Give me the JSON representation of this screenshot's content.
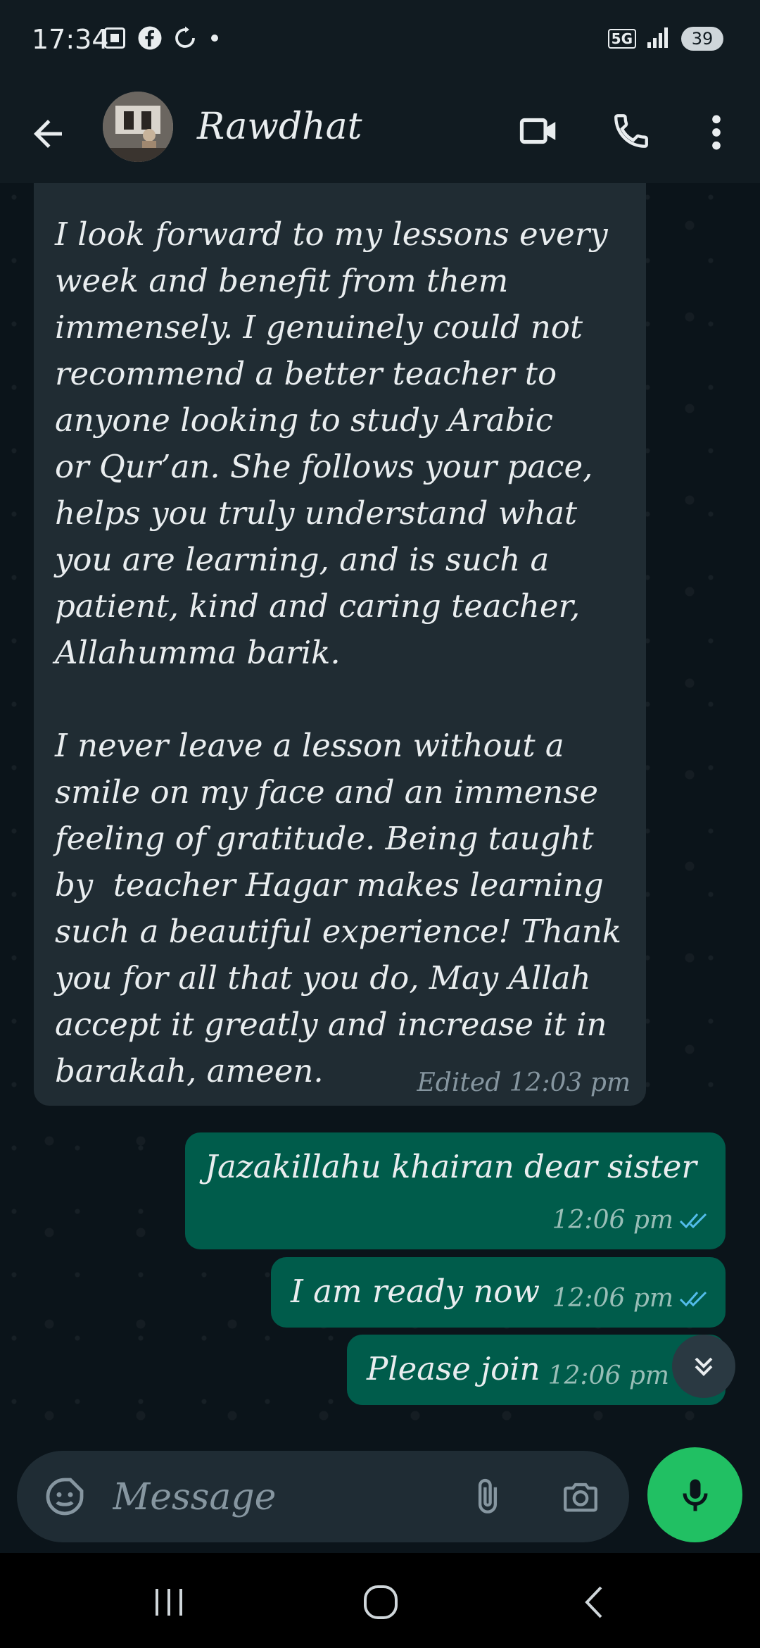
{
  "status_bar": {
    "time": "17:34",
    "network": "5G",
    "battery": "39"
  },
  "header": {
    "contact_name": "Rawdhat"
  },
  "messages": {
    "incoming": {
      "text": "I look forward to my lessons every\nweek and benefit from them\nimmensely. I genuinely could not\nrecommend a better teacher to\nanyone looking to study Arabic\nor Qur’an. She follows your pace,\nhelps you truly understand what\nyou are learning, and is such a\npatient, kind and caring teacher,\nAllahumma barik.\n\nI never leave a lesson without a\nsmile on my face and an immense\nfeeling of gratitude. Being taught\nby  teacher Hagar makes learning\nsuch a beautiful experience! Thank\nyou for all that you do, May Allah\naccept it greatly and increase it in\nbarakah, ameen.",
      "meta": "Edited 12:03 pm"
    },
    "outgoing": [
      {
        "text": "Jazakillahu khairan dear sister",
        "time": "12:06 pm"
      },
      {
        "text": "I am ready now",
        "time": "12:06 pm"
      },
      {
        "text": "Please join",
        "time": "12:06 pm"
      }
    ]
  },
  "composer": {
    "placeholder": "Message"
  },
  "colors": {
    "accent": "#21c063",
    "outgoing_bubble": "#005c4b",
    "incoming_bubble": "#202c33",
    "read_ticks": "#53bdeb"
  }
}
